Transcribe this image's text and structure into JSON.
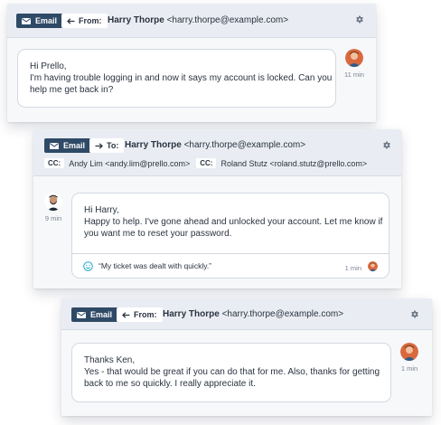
{
  "threads": [
    {
      "channel": "Email",
      "direction_label": "From:",
      "sender_name": "Harry Thorpe",
      "sender_email": "<harry.thorpe@example.com>",
      "message_lines": [
        "Hi Prello,",
        "I'm having trouble logging in and now it says my account is locked.  Can you",
        "help me get back in?"
      ],
      "time": "11 min"
    },
    {
      "channel": "Email",
      "direction_label": "To:",
      "recipient_name": "Harry Thorpe",
      "recipient_email": "<harry.thorpe@example.com>",
      "cc_label": "CC:",
      "cc": [
        "Andy Lim <andy.lim@prello.com>",
        "Roland Stutz <roland.stutz@prello.com>"
      ],
      "message_lines": [
        "Hi Harry,",
        "Happy to help. I've gone ahead and unlocked your account. Let me know if",
        "you want me to reset your password."
      ],
      "time": "9 min",
      "feedback": {
        "text": "“My ticket was dealt with quickly.”",
        "time": "1 min"
      }
    },
    {
      "channel": "Email",
      "direction_label": "From:",
      "sender_name": "Harry Thorpe",
      "sender_email": "<harry.thorpe@example.com>",
      "message_lines": [
        "Thanks Ken,",
        "Yes - that would be great if you can do that for me. Also, thanks for getting",
        "back to me so quickly.  I really appreciate it."
      ],
      "time": "1 min"
    }
  ],
  "icons": {
    "email_badge": "envelope-icon",
    "from": "arrow-left-icon",
    "to": "arrow-right-icon",
    "settings": "gear-icon",
    "feedback": "smile-icon"
  },
  "colors": {
    "badge": "#2f4a66",
    "header": "#e9edf3",
    "card": "#f7f8fa",
    "bubble_border": "#d3d9e2",
    "smile": "#1ea7c9"
  }
}
